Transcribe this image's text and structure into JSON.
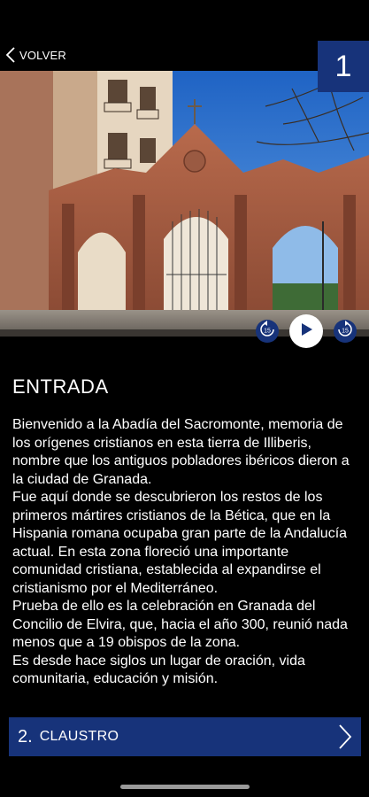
{
  "header": {
    "back_label": "VOLVER",
    "stop_number": "1"
  },
  "hero": {
    "alt": "Puerta de la Abadía del Sacromonte"
  },
  "player": {
    "rewind_label": "15",
    "forward_label": "15"
  },
  "content": {
    "title": "ENTRADA",
    "paragraphs": [
      "Bienvenido a la Abadía del Sacromonte, memoria de los orígenes cristianos en esta tierra de Illiberis, nombre que los antiguos pobladores ibéricos dieron a la ciudad de Granada.",
      "Fue aquí donde se descubrieron los restos de los primeros mártires cristianos de la Bética, que en la Hispania romana ocupaba gran parte de la Andalucía actual. En esta zona floreció una importante comunidad cristiana, establecida al expandirse el cristianismo por el Mediterráneo.",
      "Prueba de ello es la celebración en Granada del Concilio de Elvira, que, hacia el año 300, reunió nada menos que a 19 obispos de la zona.",
      "Es desde hace siglos un lugar de oración, vida comunitaria, educación y misión."
    ]
  },
  "next": {
    "number": "2.",
    "label": "CLAUSTRO"
  },
  "colors": {
    "accent": "#17337a",
    "background": "#000000"
  }
}
